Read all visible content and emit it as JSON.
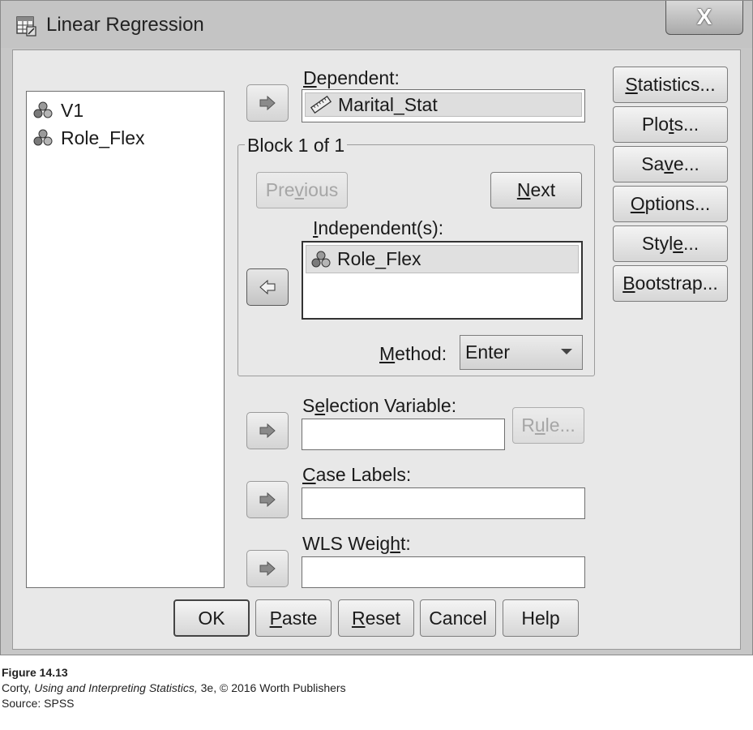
{
  "window": {
    "title": "Linear Regression",
    "close_label": "X"
  },
  "variables": [
    {
      "label": "V1",
      "icon": "nominal-variable-icon"
    },
    {
      "label": "Role_Flex",
      "icon": "nominal-variable-icon"
    }
  ],
  "dependent": {
    "label_u": "D",
    "label_rest": "ependent:",
    "value": "Marital_Stat",
    "icon": "scale-ruler-icon"
  },
  "block": {
    "title": "Block 1 of 1",
    "previous_pre": "Pre",
    "previous_u": "v",
    "previous_post": "ious",
    "next_u": "N",
    "next_rest": "ext"
  },
  "independents": {
    "label_u": "I",
    "label_rest": "ndependent(s):",
    "items": [
      {
        "label": "Role_Flex",
        "icon": "nominal-variable-icon"
      }
    ]
  },
  "method": {
    "label_u": "M",
    "label_rest": "ethod:",
    "value": "Enter"
  },
  "selection_variable": {
    "label_pre": "S",
    "label_u": "e",
    "label_rest": "lection Variable:",
    "value": "",
    "rule_pre": "R",
    "rule_u": "u",
    "rule_post": "le..."
  },
  "case_labels": {
    "label_u": "C",
    "label_rest": "ase Labels:",
    "value": ""
  },
  "wls_weight": {
    "label_pre": "WLS Weig",
    "label_u": "h",
    "label_rest": "t:",
    "value": ""
  },
  "side_buttons": {
    "statistics": {
      "u": "S",
      "rest": "tatistics..."
    },
    "plots": {
      "pre": "Plo",
      "u": "t",
      "rest": "s..."
    },
    "save": {
      "pre": "Sa",
      "u": "v",
      "rest": "e..."
    },
    "options": {
      "u": "O",
      "rest": "ptions..."
    },
    "style": {
      "pre": "Styl",
      "u": "e",
      "rest": "..."
    },
    "bootstrap": {
      "u": "B",
      "rest": "ootstrap..."
    }
  },
  "footer_buttons": {
    "ok": "OK",
    "paste": {
      "u": "P",
      "rest": "aste"
    },
    "reset": {
      "u": "R",
      "rest": "eset"
    },
    "cancel": "Cancel",
    "help": "Help"
  },
  "caption": {
    "figure": "Figure 14.13",
    "line2_pre": "Corty, ",
    "line2_title": "Using and Interpreting Statistics,",
    "line2_post": " 3e, © 2016 Worth Publishers",
    "line3": "Source: SPSS"
  },
  "colors": {
    "dialog_bg": "#e8e8e8",
    "frame_bg": "#c7c7c7",
    "disabled_text": "#a6a6a6"
  }
}
